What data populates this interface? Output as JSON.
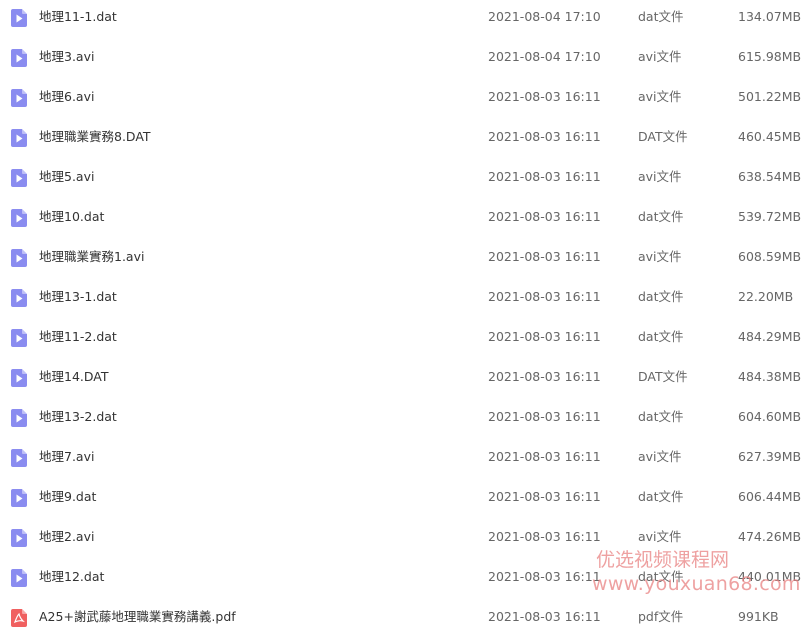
{
  "colors": {
    "video_icon": "#8A8CF0",
    "pdf_icon": "#F06060",
    "watermark": "#E88282"
  },
  "files": [
    {
      "name": "地理11-1.dat",
      "date": "2021-08-04 17:10",
      "type": "dat文件",
      "size": "134.07MB",
      "icon": "video-file-icon"
    },
    {
      "name": "地理3.avi",
      "date": "2021-08-04 17:10",
      "type": "avi文件",
      "size": "615.98MB",
      "icon": "video-file-icon"
    },
    {
      "name": "地理6.avi",
      "date": "2021-08-03 16:11",
      "type": "avi文件",
      "size": "501.22MB",
      "icon": "video-file-icon"
    },
    {
      "name": "地理職業實務8.DAT",
      "date": "2021-08-03 16:11",
      "type": "DAT文件",
      "size": "460.45MB",
      "icon": "video-file-icon"
    },
    {
      "name": "地理5.avi",
      "date": "2021-08-03 16:11",
      "type": "avi文件",
      "size": "638.54MB",
      "icon": "video-file-icon"
    },
    {
      "name": "地理10.dat",
      "date": "2021-08-03 16:11",
      "type": "dat文件",
      "size": "539.72MB",
      "icon": "video-file-icon"
    },
    {
      "name": "地理職業實務1.avi",
      "date": "2021-08-03 16:11",
      "type": "avi文件",
      "size": "608.59MB",
      "icon": "video-file-icon"
    },
    {
      "name": "地理13-1.dat",
      "date": "2021-08-03 16:11",
      "type": "dat文件",
      "size": "22.20MB",
      "icon": "video-file-icon"
    },
    {
      "name": "地理11-2.dat",
      "date": "2021-08-03 16:11",
      "type": "dat文件",
      "size": "484.29MB",
      "icon": "video-file-icon"
    },
    {
      "name": "地理14.DAT",
      "date": "2021-08-03 16:11",
      "type": "DAT文件",
      "size": "484.38MB",
      "icon": "video-file-icon"
    },
    {
      "name": "地理13-2.dat",
      "date": "2021-08-03 16:11",
      "type": "dat文件",
      "size": "604.60MB",
      "icon": "video-file-icon"
    },
    {
      "name": "地理7.avi",
      "date": "2021-08-03 16:11",
      "type": "avi文件",
      "size": "627.39MB",
      "icon": "video-file-icon"
    },
    {
      "name": "地理9.dat",
      "date": "2021-08-03 16:11",
      "type": "dat文件",
      "size": "606.44MB",
      "icon": "video-file-icon"
    },
    {
      "name": "地理2.avi",
      "date": "2021-08-03 16:11",
      "type": "avi文件",
      "size": "474.26MB",
      "icon": "video-file-icon"
    },
    {
      "name": "地理12.dat",
      "date": "2021-08-03 16:11",
      "type": "dat文件",
      "size": "440.01MB",
      "icon": "video-file-icon"
    },
    {
      "name": "A25+謝武藤地理職業實務講義.pdf",
      "date": "2021-08-03 16:11",
      "type": "pdf文件",
      "size": "991KB",
      "icon": "pdf-file-icon"
    }
  ],
  "watermark": {
    "line1": "优选视频课程网",
    "line2": "www.youxuan68.com"
  }
}
